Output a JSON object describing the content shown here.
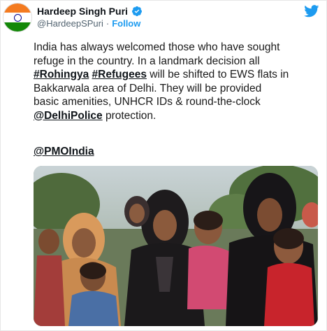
{
  "author": {
    "name": "Hardeep Singh Puri",
    "handle": "@HardeepSPuri",
    "separator": "·",
    "follow_label": "Follow"
  },
  "icons": {
    "verified": "verified-badge-icon",
    "twitter": "twitter-bird-icon"
  },
  "colors": {
    "accent": "#1d9bf0",
    "text": "#0f1419",
    "secondary": "#536471"
  },
  "tweet": {
    "line1": "India has always welcomed those who have sought",
    "line2": "refuge in the country. In a landmark decision all",
    "tag1": "#Rohingya",
    "tag2": "#Refugees",
    "line3_rest": " will be shifted to EWS flats in",
    "line4": "Bakkarwala area of Delhi. They will be provided",
    "line5": "basic amenities, UNHCR IDs & round-the-clock",
    "mention_police": "@DelhiPolice",
    "line6_rest": " protection.",
    "mention_pmo": "@PMOIndia"
  }
}
